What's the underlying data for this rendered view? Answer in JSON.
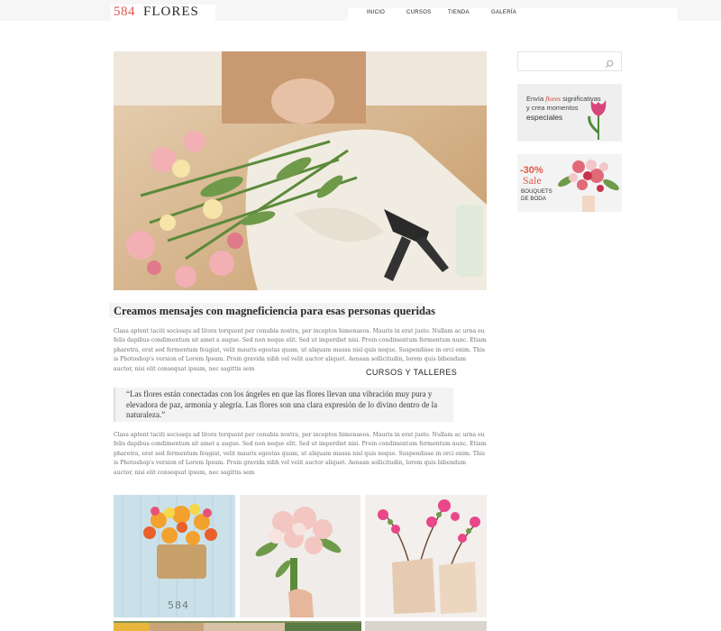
{
  "header": {
    "logo_number": "584",
    "logo_name": "FLORES",
    "nav": [
      {
        "label": "INICIO"
      },
      {
        "label": "CURSOS"
      },
      {
        "label": "TIENDA"
      },
      {
        "label": "GALERÍA"
      }
    ]
  },
  "article": {
    "headline": "Creamos mensajes con magneficiencia para esas personas queridas",
    "paragraph1": "Class aptent taciti sociosqu ad litora torquent per conubia nostra, per inceptos himenaeos. Mauris in erat justo. Nullam ac urna eu felis dapibus condimentum sit amet a augue. Sed non neque elit. Sed ut imperdiet nisi. Proin condimentum fermentum nunc. Etiam pharetra, erat sed fermentum feugiat, velit mauris egestas quam, ut aliquam massa nisl quis neque. Suspendisse in orci enim. This is Photoshop's version of Lorem Ipsum. Proin gravida nibh vel velit auctor aliquet. Aenean sollicitudin, lorem quis bibendum auctor, nisi elit consequat ipsum, nec sagittis sem",
    "section_label": "CURSOS Y TALLERES",
    "quote": "“Las flores están conectadas con los ángeles en que las flores llevan una vibración muy pura y elevadora de paz, armonía y alegría. Las flores son una clara expresión de lo divino dentro de la naturaleza.”",
    "paragraph2": "Class aptent taciti sociosqu ad litora torquent per conubia nostra, per inceptos himenaeos. Mauris in erat justo. Nullam ac urna eu felis dapibus condimentum sit amet a augue. Sed non neque elit. Sed ut imperdiet nisi. Proin condimentum fermentum nunc. Etiam pharetra, erat sed fermentum feugiat, velit mauris egestas quam, ut aliquam massa nisl quis neque. Suspendisse in orci enim. This is Photoshop's version of Lorem Ipsum. Proin gravida nibh vel velit auctor aliquet. Aenean sollicitudin, lorem quis bibendum auctor, nisi elit consequat ipsum, nec sagittis sem"
  },
  "sidebar": {
    "search": {
      "placeholder": "",
      "value": "",
      "icon": "search-icon"
    },
    "promo1": {
      "line1_prefix": "Envía ",
      "line1_accent": "flores",
      "line1_suffix": " significativas",
      "line2": "y crea momentos",
      "line3": "especiales"
    },
    "promo2": {
      "discount": "-30%",
      "sale": "Sale",
      "line1": "BOUQUETS",
      "line2": "DE BODA"
    }
  },
  "gallery_plate_number": "584",
  "colors": {
    "accent": "#e2574c",
    "header_bg": "#f6f6f6",
    "panel_bg": "#f3f3f3",
    "body_text": "#707070"
  }
}
